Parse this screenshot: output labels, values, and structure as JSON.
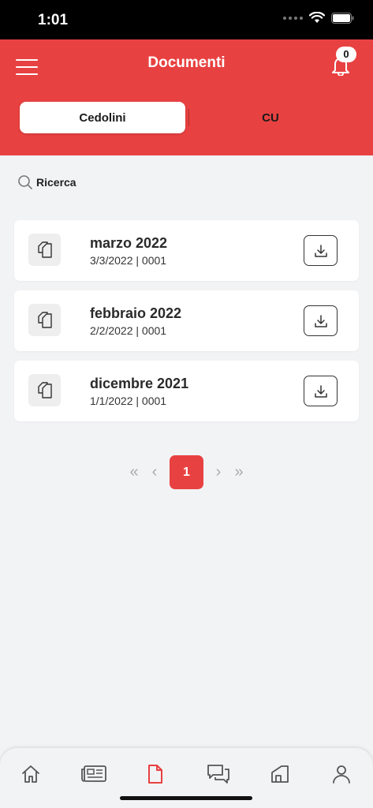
{
  "status_bar": {
    "time": "1:01"
  },
  "header": {
    "title": "Documenti",
    "notification_count": "0",
    "tabs": [
      {
        "label": "Cedolini",
        "active": true
      },
      {
        "label": "CU",
        "active": false
      }
    ]
  },
  "search": {
    "label": "Ricerca"
  },
  "documents": [
    {
      "title": "marzo 2022",
      "subtitle": "3/3/2022 | 0001"
    },
    {
      "title": "febbraio 2022",
      "subtitle": "2/2/2022 | 0001"
    },
    {
      "title": "dicembre 2021",
      "subtitle": "1/1/2022 | 0001"
    }
  ],
  "pagination": {
    "first": "«",
    "prev": "‹",
    "current_page": "1",
    "next": "›",
    "last": "»"
  },
  "tabbar": {
    "items": [
      {
        "icon": "home-icon",
        "active": false
      },
      {
        "icon": "newspaper-icon",
        "active": false
      },
      {
        "icon": "document-icon",
        "active": true
      },
      {
        "icon": "chat-icon",
        "active": false
      },
      {
        "icon": "building-icon",
        "active": false
      },
      {
        "icon": "user-icon",
        "active": false
      }
    ]
  },
  "colors": {
    "accent": "#e84141",
    "background": "#f2f3f5",
    "card": "#ffffff",
    "tab_inactive": "#555555"
  }
}
